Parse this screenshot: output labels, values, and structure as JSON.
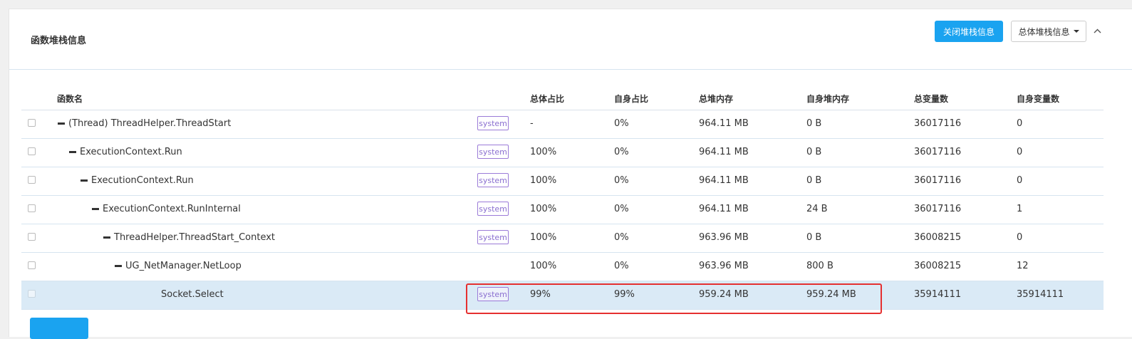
{
  "panel": {
    "title": "函数堆栈信息",
    "close_button_label": "关闭堆栈信息",
    "dropdown_label": "总体堆栈信息"
  },
  "table": {
    "columns": [
      "函数名",
      "总体占比",
      "自身占比",
      "总堆内存",
      "自身堆内存",
      "总变量数",
      "自身变量数"
    ],
    "rows": [
      {
        "name": "(Thread) ThreadHelper.ThreadStart",
        "expanded": true,
        "depth": 0,
        "tag": "system",
        "total_pct": "-",
        "self_pct": "0%",
        "total_heap": "964.11 MB",
        "self_heap": "0 B",
        "total_vars": "36017116",
        "self_vars": "0"
      },
      {
        "name": "ExecutionContext.Run",
        "expanded": true,
        "depth": 1,
        "tag": "system",
        "total_pct": "100%",
        "self_pct": "0%",
        "total_heap": "964.11 MB",
        "self_heap": "0 B",
        "total_vars": "36017116",
        "self_vars": "0"
      },
      {
        "name": "ExecutionContext.Run",
        "expanded": true,
        "depth": 2,
        "tag": "system",
        "total_pct": "100%",
        "self_pct": "0%",
        "total_heap": "964.11 MB",
        "self_heap": "0 B",
        "total_vars": "36017116",
        "self_vars": "0"
      },
      {
        "name": "ExecutionContext.RunInternal",
        "expanded": true,
        "depth": 3,
        "tag": "system",
        "total_pct": "100%",
        "self_pct": "0%",
        "total_heap": "964.11 MB",
        "self_heap": "24 B",
        "total_vars": "36017116",
        "self_vars": "1"
      },
      {
        "name": "ThreadHelper.ThreadStart_Context",
        "expanded": true,
        "depth": 4,
        "tag": "system",
        "total_pct": "100%",
        "self_pct": "0%",
        "total_heap": "963.96 MB",
        "self_heap": "0 B",
        "total_vars": "36008215",
        "self_vars": "0"
      },
      {
        "name": "UG_NetManager.NetLoop",
        "expanded": true,
        "depth": 5,
        "tag": "",
        "total_pct": "100%",
        "self_pct": "0%",
        "total_heap": "963.96 MB",
        "self_heap": "800 B",
        "total_vars": "36008215",
        "self_vars": "12"
      },
      {
        "name": "Socket.Select",
        "expanded": false,
        "depth": 6,
        "tag": "system",
        "total_pct": "99%",
        "self_pct": "99%",
        "total_heap": "959.24 MB",
        "self_heap": "959.24 MB",
        "total_vars": "35914111",
        "self_vars": "35914111",
        "selected": true
      }
    ]
  },
  "colors": {
    "primary": "#1aa3f0",
    "tag_border": "#9b7bd8",
    "selected_row": "#daeaf6",
    "highlight": "#e53030"
  }
}
